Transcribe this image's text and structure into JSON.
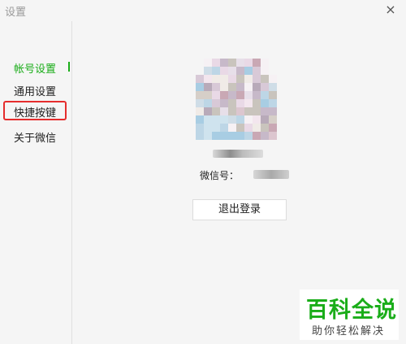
{
  "window": {
    "title": "设置"
  },
  "sidebar": {
    "items": [
      {
        "label": "帐号设置",
        "active": true
      },
      {
        "label": "通用设置",
        "active": false
      },
      {
        "label": "快捷按键",
        "active": false,
        "highlighted": true
      },
      {
        "label": "关于微信",
        "active": false
      }
    ]
  },
  "account": {
    "wechat_id_label": "微信号：",
    "logout_label": "退出登录"
  },
  "watermark": {
    "title": "百科全说",
    "subtitle": "助你轻松解决"
  },
  "colors": {
    "accent": "#1aad19",
    "highlight": "#e52d2d"
  }
}
